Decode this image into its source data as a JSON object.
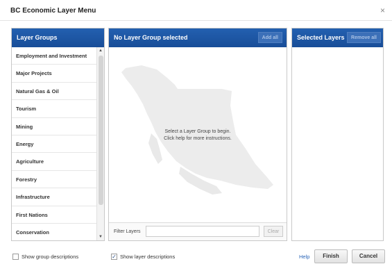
{
  "window": {
    "title": "BC Economic Layer Menu",
    "close_glyph": "×"
  },
  "groups_panel": {
    "header": "Layer Groups",
    "items": [
      "Employment and Investment",
      "Major Projects",
      "Natural Gas & Oil",
      "Tourism",
      "Mining",
      "Energy",
      "Agriculture",
      "Forestry",
      "Infrastructure",
      "First Nations",
      "Conservation"
    ],
    "scroll_up_glyph": "▲",
    "scroll_down_glyph": "▼"
  },
  "main_panel": {
    "header": "No Layer Group selected",
    "add_all_label": "Add all",
    "instructions_line1": "Select a Layer Group to begin.",
    "instructions_line2": "Click help for more instructions.",
    "filter_label": "Filter Layers",
    "filter_value": "",
    "filter_placeholder": "",
    "clear_label": "Clear",
    "map_icon": "bc-province-map-icon"
  },
  "selected_panel": {
    "header": "Selected Layers",
    "remove_all_label": "Remove all"
  },
  "footer": {
    "show_group_descriptions": {
      "label": "Show group descriptions",
      "checked": false
    },
    "show_layer_descriptions": {
      "label": "Show layer descriptions",
      "checked": true,
      "check_glyph": "✓"
    },
    "help_label": "Help",
    "finish_label": "Finish",
    "cancel_label": "Cancel"
  },
  "colors": {
    "header_blue": "#1f58a6",
    "map_gray": "#eeeeee",
    "link_blue": "#2b66b8"
  }
}
